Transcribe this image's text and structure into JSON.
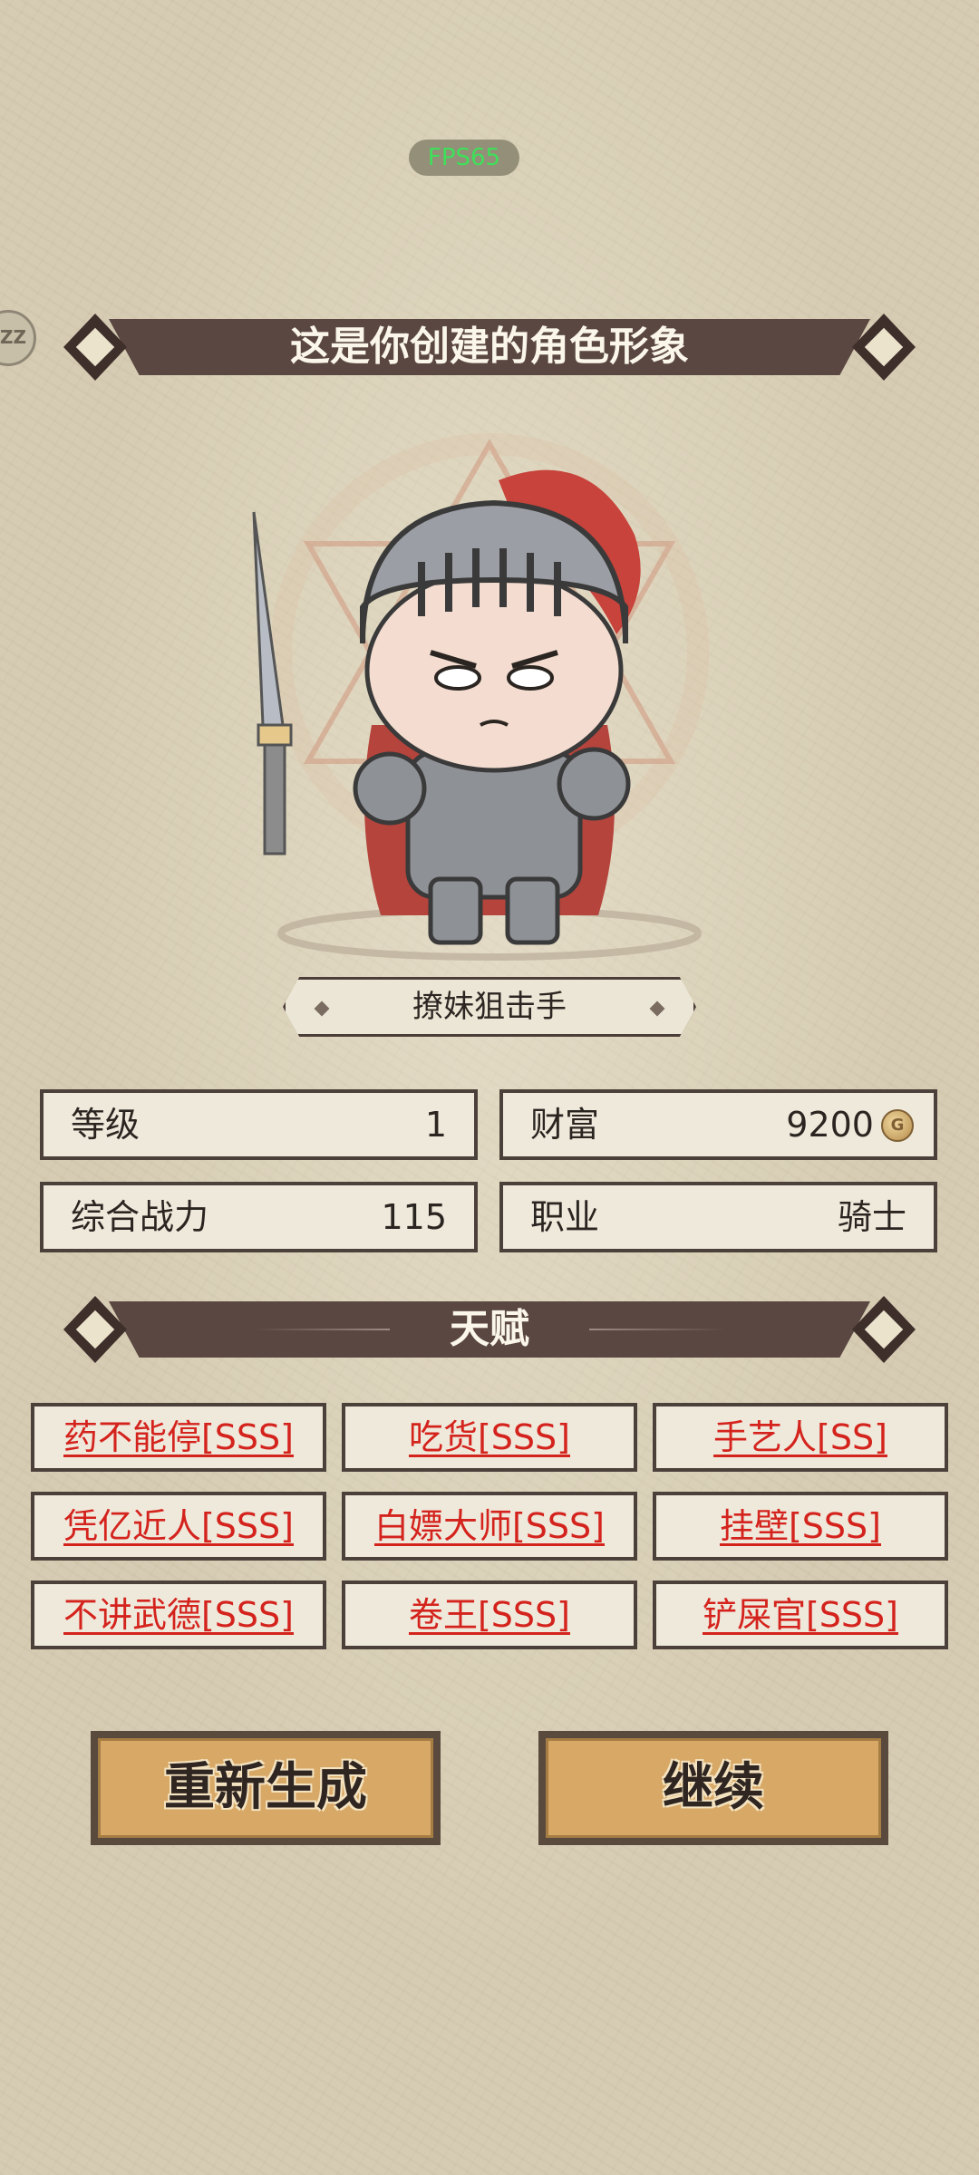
{
  "hud": {
    "fps_text": "FPS65",
    "side_button_text": "ZZ"
  },
  "header": {
    "title": "这是你创建的角色形象"
  },
  "character": {
    "name": "撩妹狙击手"
  },
  "stats": {
    "level_label": "等级",
    "level_value": "1",
    "wealth_label": "财富",
    "wealth_value": "9200",
    "power_label": "综合战力",
    "power_value": "115",
    "class_label": "职业",
    "class_value": "骑士"
  },
  "talents": {
    "title": "天赋",
    "items": [
      "药不能停[SSS]",
      "吃货[SSS]",
      "手艺人[SS]",
      "凭亿近人[SSS]",
      "白嫖大师[SSS]",
      "挂壁[SSS]",
      "不讲武德[SSS]",
      "卷王[SSS]",
      "铲屎官[SSS]"
    ]
  },
  "buttons": {
    "regenerate": "重新生成",
    "continue": "继续"
  },
  "colors": {
    "banner": "#5a4741",
    "talent_text": "#d4231d",
    "button": "#d8a866"
  },
  "icons": {
    "coin": "coin-icon",
    "hero": "knight-character"
  }
}
